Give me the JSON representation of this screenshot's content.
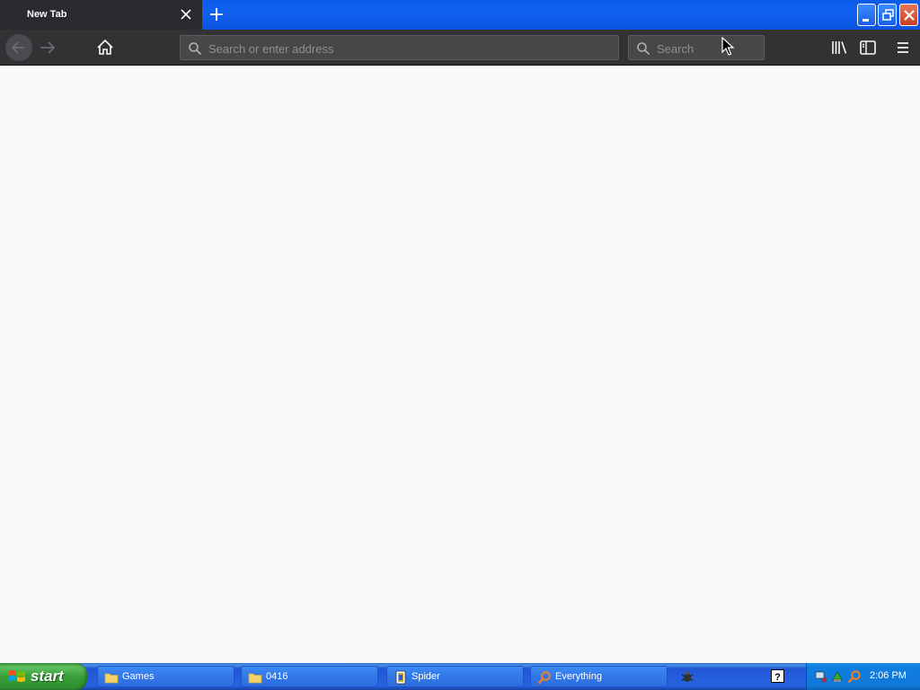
{
  "browser": {
    "tab": {
      "title": "New Tab"
    },
    "urlbar": {
      "placeholder": "Search or enter address"
    },
    "searchbar": {
      "placeholder": "Search"
    }
  },
  "taskbar": {
    "start_label": "start",
    "tasks": [
      {
        "label": "Games",
        "icon": "folder-icon"
      },
      {
        "label": "0416",
        "icon": "folder-icon"
      },
      {
        "label": "Spider",
        "icon": "spider-solitaire-icon"
      },
      {
        "label": "Everything",
        "icon": "magnifier-icon"
      }
    ],
    "clock": "2:06 PM"
  },
  "colors": {
    "title_blue": "#0b55e0",
    "tab_dark": "#2a2a2e",
    "toolbar": "#323234",
    "content_bg": "#f9f9fa",
    "start_green": "#38a038",
    "taskbar_blue": "#2663e0"
  }
}
